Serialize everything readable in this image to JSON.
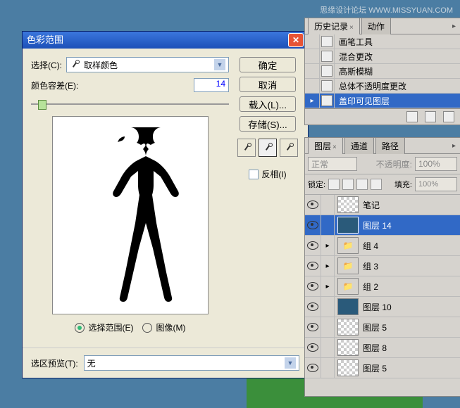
{
  "watermark": "思缘设计论坛 WWW.MISSYUAN.COM",
  "dialog": {
    "title": "色彩范围",
    "select_label": "选择(C):",
    "select_value": "取样颜色",
    "fuzziness_label": "颜色容差(E):",
    "fuzziness_value": "14",
    "buttons": {
      "ok": "确定",
      "cancel": "取消",
      "load": "载入(L)...",
      "save": "存储(S)..."
    },
    "invert": "反相(I)",
    "radio_selection": "选择范围(E)",
    "radio_image": "图像(M)",
    "preview_label": "选区预览(T):",
    "preview_value": "无"
  },
  "history": {
    "tab_history": "历史记录",
    "tab_actions": "动作",
    "items": [
      "画笔工具",
      "混合更改",
      "高斯模糊",
      "总体不透明度更改",
      "盖印可见图层"
    ]
  },
  "layers": {
    "tab_layers": "图层",
    "tab_channels": "通道",
    "tab_paths": "路径",
    "blend_mode": "正常",
    "opacity_label": "不透明度:",
    "opacity_value": "100%",
    "lock_label": "锁定:",
    "fill_label": "填充:",
    "fill_value": "100%",
    "items": [
      {
        "name": "笔记",
        "type": "layer",
        "thumb": "checker"
      },
      {
        "name": "图层 14",
        "type": "layer",
        "thumb": "blue",
        "selected": true
      },
      {
        "name": "组 4",
        "type": "group"
      },
      {
        "name": "组 3",
        "type": "group"
      },
      {
        "name": "组 2",
        "type": "group"
      },
      {
        "name": "图层 10",
        "type": "layer",
        "thumb": "blue"
      },
      {
        "name": "图层 5",
        "type": "layer",
        "thumb": "checker"
      },
      {
        "name": "图层 8",
        "type": "layer",
        "thumb": "checker"
      },
      {
        "name": "图层 5",
        "type": "layer",
        "thumb": "checker"
      }
    ]
  }
}
